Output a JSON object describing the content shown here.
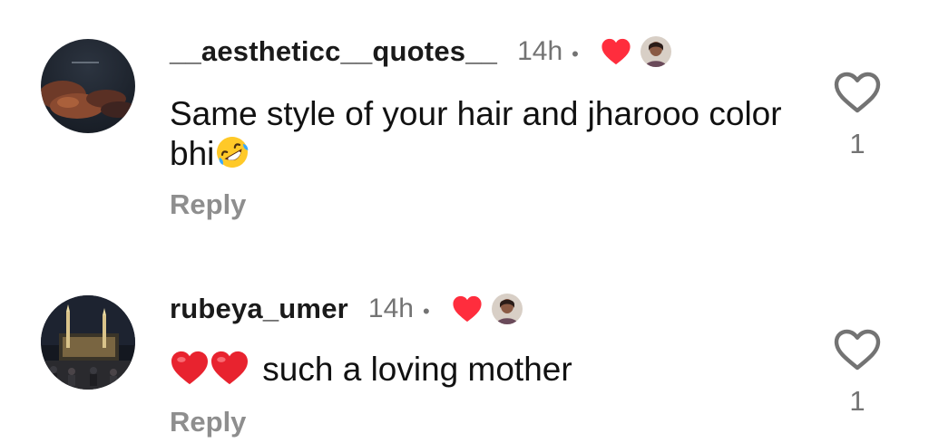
{
  "comments": [
    {
      "username": "__aestheticc__quotes__",
      "time": "14h",
      "separator": "•",
      "text": "Same style of your hair and jharooo color bhi",
      "emoji_icons": [
        "rolling-on-floor-laughing-emoji"
      ],
      "reply_label": "Reply",
      "like_count": "1",
      "liked_by_creator": true
    },
    {
      "username": "rubeya_umer",
      "time": "14h",
      "separator": "•",
      "text": "such a loving mother",
      "emoji_icons": [
        "red-heart-emoji",
        "red-heart-emoji"
      ],
      "reply_label": "Reply",
      "like_count": "1",
      "liked_by_creator": true
    }
  ],
  "colors": {
    "username": "#1a1a1a",
    "secondary_text": "#737373",
    "reply": "#8e8e8e",
    "creator_heart": "#ff2d3d",
    "emoji_heart": "#e8232f",
    "background": "#ffffff"
  },
  "icons": {
    "like": "heart-outline-icon",
    "creator_like": "heart-filled-icon"
  }
}
